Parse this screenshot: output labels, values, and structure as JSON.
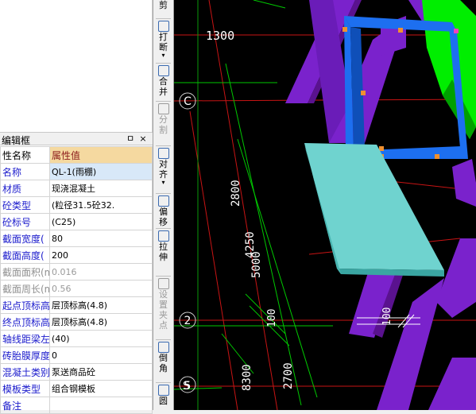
{
  "panel": {
    "title": "编辑框",
    "pin_glyph": "ㅁ",
    "close_glyph": "×",
    "header": {
      "name": "性名称",
      "value": "属性值"
    },
    "rows": [
      {
        "name": "名称",
        "value": "QL-1(雨棚)",
        "style": "link",
        "selected": true
      },
      {
        "name": "材质",
        "value": "现浇混凝土",
        "style": "link"
      },
      {
        "name": "砼类型",
        "value": "(粒径31.5砼32.",
        "style": "link"
      },
      {
        "name": "砼标号",
        "value": "(C25)",
        "style": "link"
      },
      {
        "name": "截面宽度(",
        "value": "80",
        "style": "link"
      },
      {
        "name": "截面高度(",
        "value": "200",
        "style": "link"
      },
      {
        "name": "截面面积(m",
        "value": "0.016",
        "style": "gray"
      },
      {
        "name": "截面周长(m",
        "value": "0.56",
        "style": "gray"
      },
      {
        "name": "起点顶标高",
        "value": "层顶标高(4.8)",
        "style": "link"
      },
      {
        "name": "终点顶标高",
        "value": "层顶标高(4.8)",
        "style": "link"
      },
      {
        "name": "轴线距梁左",
        "value": "(40)",
        "style": "link"
      },
      {
        "name": "砖胎膜厚度",
        "value": "0",
        "style": "link"
      },
      {
        "name": "混凝土类别",
        "value": "泵送商品砼",
        "style": "link"
      },
      {
        "name": "模板类型",
        "value": "组合钢模板",
        "style": "link"
      },
      {
        "name": "备注",
        "value": "",
        "style": "link"
      }
    ]
  },
  "toolbar": {
    "items": [
      {
        "label": "剪",
        "icon": "scissors-icon",
        "dim": false
      },
      {
        "label": "打断",
        "icon": "break-icon",
        "dim": false,
        "arrow": "▾"
      },
      {
        "label": "合并",
        "icon": "merge-icon",
        "dim": false
      },
      {
        "label": "分割",
        "icon": "split-icon",
        "dim": true
      },
      {
        "label": "对齐",
        "icon": "align-icon",
        "dim": false,
        "arrow": "▾"
      },
      {
        "label": "偏移",
        "icon": "offset-icon",
        "dim": false
      },
      {
        "label": "拉伸",
        "icon": "stretch-icon",
        "dim": false
      },
      {
        "label": "设置夹点",
        "icon": "grip-icon",
        "dim": true
      },
      {
        "label": "倒角",
        "icon": "chamfer-icon",
        "dim": false
      },
      {
        "label": "圆",
        "icon": "fillet-icon",
        "dim": false
      }
    ]
  },
  "canvas": {
    "background": "#000000",
    "labels": {
      "dim_1300": "1300",
      "axis_c": "C",
      "axis_2": "2",
      "axis_5": "5",
      "dim_2800": "2800",
      "dim_4250": "4250",
      "dim_5000": "5000",
      "dim_100_a": "100",
      "dim_100_b": "100",
      "dim_8300": "8300",
      "dim_2700": "2700"
    },
    "colors": {
      "beam_purple": "#7a22cc",
      "frame_blue": "#1d6ff0",
      "column_green": "#00ff00",
      "slab_cyan": "#6fd3cf",
      "grid_red": "#c81414",
      "grid_green": "#00c800"
    }
  }
}
